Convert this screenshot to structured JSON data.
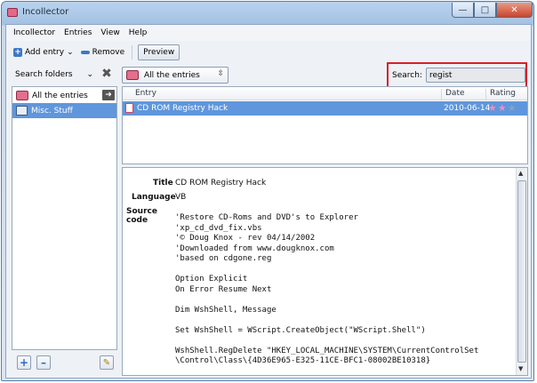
{
  "window": {
    "title": "Incollector"
  },
  "menu": [
    "Incollector",
    "Entries",
    "View",
    "Help"
  ],
  "toolbar": {
    "add_label": "Add entry",
    "remove_label": "Remove",
    "preview_label": "Preview"
  },
  "folders": {
    "search_placeholder": "Search folders",
    "items": [
      "All the entries",
      "Misc. Stuff"
    ]
  },
  "filter": {
    "selected": "All the entries"
  },
  "search": {
    "label": "Search:",
    "value": "regist"
  },
  "list": {
    "columns": {
      "entry": "Entry",
      "date": "Date",
      "rating": "Rating"
    },
    "rows": [
      {
        "entry": "CD ROM Registry Hack",
        "date": "2010-06-14",
        "rating": 2,
        "max_rating": 3
      }
    ]
  },
  "detail": {
    "title_label": "Title",
    "title_value": "CD ROM Registry Hack",
    "language_label": "Language",
    "language_value": "VB",
    "source_label": "Source code",
    "source_code": "'Restore CD-Roms and DVD's to Explorer\n'xp_cd_dvd_fix.vbs\n'© Doug Knox - rev 04/14/2002\n'Downloaded from www.dougknox.com\n'based on cdgone.reg\n\nOption Explicit\nOn Error Resume Next\n\nDim WshShell, Message\n\nSet WshShell = WScript.CreateObject(\"WScript.Shell\")\n\nWshShell.RegDelete \"HKEY_LOCAL_MACHINE\\SYSTEM\\CurrentControlSet\n\\Control\\Class\\{4D36E965-E325-11CE-BFC1-08002BE10318}"
  },
  "colors": {
    "selection": "#5f96dc",
    "highlight_box": "#d6202a",
    "star_on": "#f08cc6"
  }
}
